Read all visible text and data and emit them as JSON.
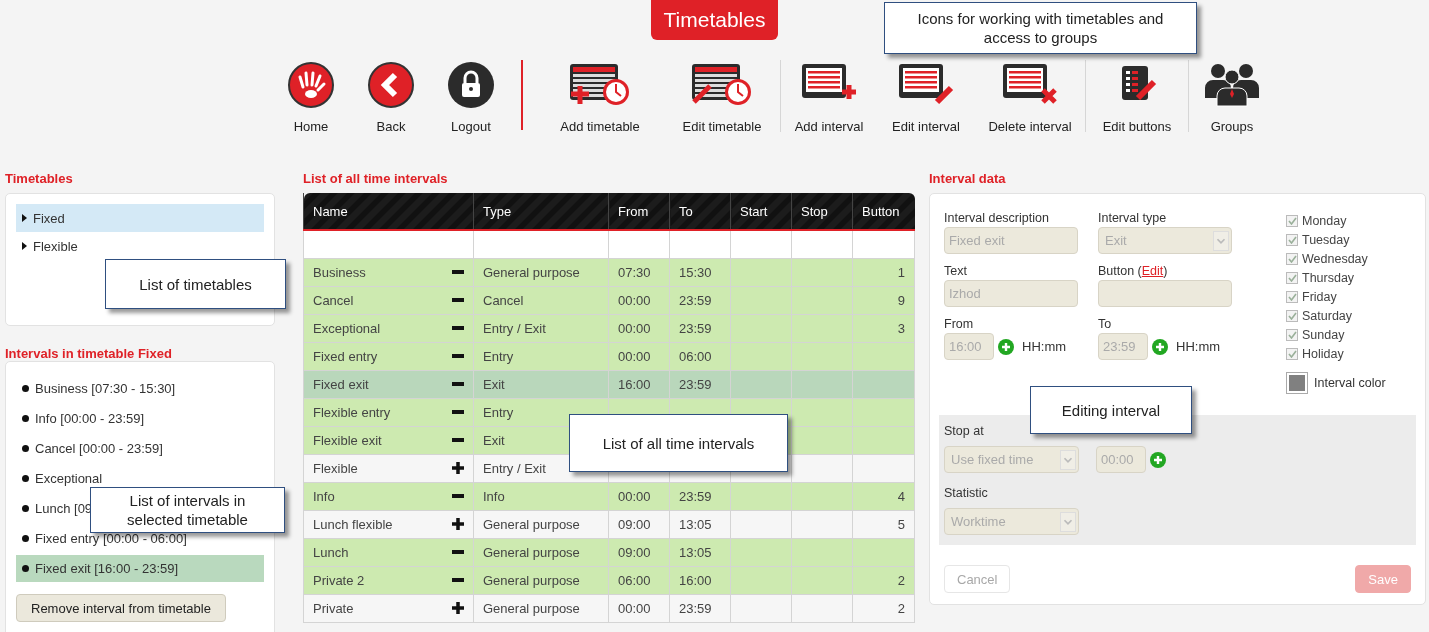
{
  "title": "Timetables",
  "toolbar": [
    [
      {
        "kind": "home",
        "label": "Home"
      },
      {
        "kind": "back",
        "label": "Back"
      },
      {
        "kind": "logout",
        "label": "Logout"
      }
    ],
    [
      {
        "kind": "add-timetable",
        "label": "Add timetable"
      },
      {
        "kind": "edit-timetable",
        "label": "Edit timetable"
      }
    ],
    [
      {
        "kind": "add-interval",
        "label": "Add interval"
      },
      {
        "kind": "edit-interval",
        "label": "Edit interval"
      },
      {
        "kind": "delete-interval",
        "label": "Delete interval"
      }
    ],
    [
      {
        "kind": "edit-buttons",
        "label": "Edit buttons"
      }
    ],
    [
      {
        "kind": "groups",
        "label": "Groups"
      }
    ]
  ],
  "timetables": {
    "heading": "Timetables",
    "items": [
      {
        "label": "Fixed",
        "selected": true
      },
      {
        "label": "Flexible",
        "selected": false
      }
    ]
  },
  "intervals_in_timetable": {
    "heading": "Intervals in timetable Fixed",
    "items": [
      {
        "label": "Business [07:30 - 15:30]",
        "selected": false
      },
      {
        "label": "Info [00:00 - 23:59]",
        "selected": false
      },
      {
        "label": "Cancel [00:00 - 23:59]",
        "selected": false
      },
      {
        "label": "Exceptional",
        "selected": false
      },
      {
        "label": "Lunch [09",
        "selected": false
      },
      {
        "label": "Fixed entry [00:00 - 06:00]",
        "selected": false
      },
      {
        "label": "Fixed exit [16:00 - 23:59]",
        "selected": true
      }
    ],
    "button": "Remove interval from timetable"
  },
  "all_intervals": {
    "heading": "List of all time intervals",
    "columns": [
      "Name",
      "Type",
      "From",
      "To",
      "Start",
      "Stop",
      "Button"
    ],
    "rows": [
      {
        "name": "Business",
        "in_timetable": true,
        "type": "General purpose",
        "from": "07:30",
        "to": "15:30",
        "button": "1",
        "selected": false
      },
      {
        "name": "Cancel",
        "in_timetable": true,
        "type": "Cancel",
        "from": "00:00",
        "to": "23:59",
        "button": "9",
        "selected": false
      },
      {
        "name": "Exceptional",
        "in_timetable": true,
        "type": "Entry / Exit",
        "from": "00:00",
        "to": "23:59",
        "button": "3",
        "selected": false
      },
      {
        "name": "Fixed entry",
        "in_timetable": true,
        "type": "Entry",
        "from": "00:00",
        "to": "06:00",
        "selected": false
      },
      {
        "name": "Fixed exit",
        "in_timetable": true,
        "type": "Exit",
        "from": "16:00",
        "to": "23:59",
        "selected": true
      },
      {
        "name": "Flexible entry",
        "in_timetable": true,
        "type": "Entry",
        "selected": false
      },
      {
        "name": "Flexible exit",
        "in_timetable": true,
        "type": "Exit",
        "selected": false
      },
      {
        "name": "Flexible",
        "in_timetable": false,
        "type": "Entry / Exit",
        "selected": false
      },
      {
        "name": "Info",
        "in_timetable": true,
        "type": "Info",
        "from": "00:00",
        "to": "23:59",
        "button": "4",
        "selected": false
      },
      {
        "name": "Lunch flexible",
        "in_timetable": false,
        "type": "General purpose",
        "from": "09:00",
        "to": "13:05",
        "button": "5",
        "selected": false
      },
      {
        "name": "Lunch",
        "in_timetable": true,
        "type": "General purpose",
        "from": "09:00",
        "to": "13:05",
        "selected": false
      },
      {
        "name": "Private 2",
        "in_timetable": true,
        "type": "General purpose",
        "from": "06:00",
        "to": "16:00",
        "button": "2",
        "selected": false
      },
      {
        "name": "Private",
        "in_timetable": false,
        "type": "General purpose",
        "from": "00:00",
        "to": "23:59",
        "button": "2",
        "selected": false
      }
    ]
  },
  "interval_data": {
    "heading": "Interval data",
    "description": {
      "label": "Interval description",
      "value": "Fixed exit"
    },
    "type": {
      "label": "Interval type",
      "value": "Exit"
    },
    "text": {
      "label": "Text",
      "value": "Izhod"
    },
    "button": {
      "label_start": "Button (",
      "link": "Edit",
      "label_end": ")"
    },
    "from": {
      "label": "From",
      "value": "16:00",
      "unit": "HH:mm"
    },
    "to": {
      "label": "To",
      "value": "23:59",
      "unit": "HH:mm"
    },
    "days": [
      {
        "label": "Monday",
        "checked": true
      },
      {
        "label": "Tuesday",
        "checked": true
      },
      {
        "label": "Wednesday",
        "checked": true
      },
      {
        "label": "Thursday",
        "checked": true
      },
      {
        "label": "Friday",
        "checked": true
      },
      {
        "label": "Saturday",
        "checked": true
      },
      {
        "label": "Sunday",
        "checked": true
      },
      {
        "label": "Holiday",
        "checked": true
      }
    ],
    "interval_color": {
      "label": "Interval color",
      "color": "#808080"
    },
    "stop_at": {
      "label": "Stop at",
      "mode": "Use fixed time",
      "time": "00:00"
    },
    "statistic": {
      "label": "Statistic",
      "value": "Worktime"
    },
    "actions": [
      {
        "kind": "cancel",
        "label": "Cancel",
        "disabled": true
      },
      {
        "kind": "save",
        "label": "Save",
        "disabled": true
      }
    ]
  },
  "callouts": [
    {
      "text": "Icons for working with timetables and access to groups"
    },
    {
      "text": "List of timetables"
    },
    {
      "text": "List of intervals in selected timetable"
    },
    {
      "text": "List of all time intervals"
    },
    {
      "text": "Editing interval"
    }
  ]
}
